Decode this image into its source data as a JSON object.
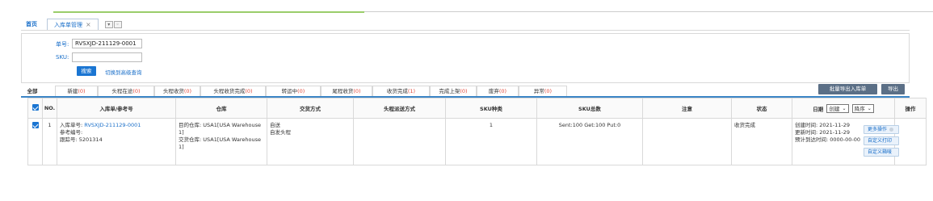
{
  "tabs": {
    "home": "首页",
    "active": "入库单管理",
    "close": "×",
    "ctrl1": "▾",
    "ctrl2": "◦"
  },
  "search": {
    "order_label": "单号:",
    "order_value": "RVSXJD-211129-0001",
    "sku_label": "SKU:",
    "sku_value": "",
    "search_button": "搜索",
    "advanced_link": "切换到高级查询"
  },
  "status_tabs": [
    {
      "label": "全部",
      "count": ""
    },
    {
      "label": "新建",
      "count": "(0)"
    },
    {
      "label": "头程在途",
      "count": "(0)"
    },
    {
      "label": "头程收货",
      "count": "(0)"
    },
    {
      "label": "头程收货完成",
      "count": "(0)"
    },
    {
      "label": "转运中",
      "count": "(0)"
    },
    {
      "label": "尾程收货",
      "count": "(0)"
    },
    {
      "label": "收货完成",
      "count": "(1)"
    },
    {
      "label": "完成上架",
      "count": "(0)"
    },
    {
      "label": "废弃",
      "count": "(0)"
    },
    {
      "label": "异常",
      "count": "(0)"
    }
  ],
  "toolbar": {
    "batch_export": "批量导出入库单",
    "export": "导出"
  },
  "table": {
    "headers": {
      "no": "NO.",
      "order": "入库单/参考号",
      "warehouse": "仓库",
      "delivery": "交货方式",
      "shipping": "头程派送方式",
      "sku_type": "SKU种类",
      "sku_total": "SKU总数",
      "note": "注意",
      "status": "状态",
      "date": "日期",
      "date_select": "创建",
      "order_select": "降序",
      "action": "操作"
    },
    "rows": [
      {
        "no": "1",
        "order_label": "入库单号:",
        "order_no": "RVSXJD-211129-0001",
        "ref_label": "参考编号:",
        "tracking": "跟踪号: 5201314",
        "warehouse_dest": "目的仓库: USA1[USA Warehouse 1]",
        "warehouse_deliver": "交货仓库: USA1[USA Warehouse 1]",
        "delivery": "自送",
        "shipping": "自发头程",
        "sku_type": "1",
        "sku_total": "Sent:100  Get:100  Put:0",
        "note": "",
        "status": "收货完成",
        "created": "创建时间: 2021-11-29",
        "updated": "更新时间: 2021-11-29",
        "eta": "预计到达时间: 0000-00-00",
        "btn_more": "更多操作",
        "btn_print": "自定义打印",
        "btn_box": "自定义箱唛"
      }
    ]
  }
}
